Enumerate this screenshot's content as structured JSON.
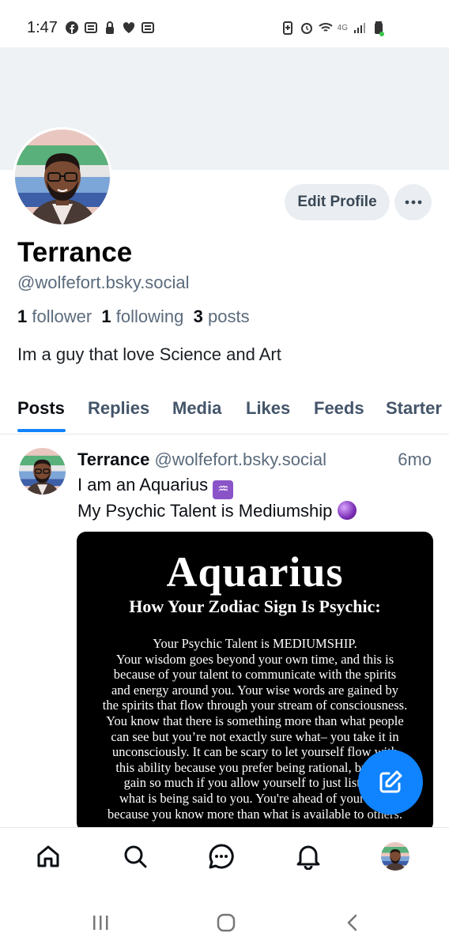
{
  "status_bar": {
    "time": "1:47",
    "left_icons": [
      "facebook-icon",
      "news-icon",
      "lock-icon",
      "heart-icon",
      "news-icon"
    ],
    "right_icons": [
      "battery-saver-icon",
      "alarm-icon",
      "wifi-icon",
      "signal-icon",
      "battery-icon"
    ],
    "network": "4G"
  },
  "profile": {
    "name": "Terrance",
    "handle": "@wolfefort.bsky.social",
    "followers_count": "1",
    "followers_label": "follower",
    "following_count": "1",
    "following_label": "following",
    "posts_count": "3",
    "posts_label": "posts",
    "bio": "Im a guy that love Science and Art",
    "edit_label": "Edit Profile",
    "more_label": "···"
  },
  "tabs": [
    {
      "label": "Posts",
      "active": true
    },
    {
      "label": "Replies",
      "active": false
    },
    {
      "label": "Media",
      "active": false
    },
    {
      "label": "Likes",
      "active": false
    },
    {
      "label": "Feeds",
      "active": false
    },
    {
      "label": "Starter",
      "active": false
    }
  ],
  "post": {
    "author": "Terrance",
    "handle": "@wolfefort.bsky.social",
    "time": "6mo",
    "line1": "I am an Aquarius",
    "line1_emoji": "♒",
    "line2": "My Psychic Talent is Mediumship",
    "line2_emoji": "crystal-ball",
    "image": {
      "title": "Aquarius",
      "subtitle": "How Your Zodiac Sign Is Psychic:",
      "body": [
        "Your Psychic Talent is MEDIUMSHIP.",
        "Your wisdom goes beyond your own time, and this is",
        "because of your talent to communicate with the spirits",
        "and energy around you. Your wise words are gained by",
        "the spirits that flow through your stream of consciousness.",
        "You know that there is something more than what people",
        "can see but you’re not exactly sure what– you take it in",
        "unconsciously. It can be scary to let yourself flow with",
        "this ability because you prefer being rational, but you",
        "gain so much if you allow yourself to just listen to",
        "what is being said to you. You're ahead of your time",
        "because you know more than what is available to others."
      ]
    }
  },
  "bottom_nav": [
    "home-icon",
    "search-icon",
    "chat-icon",
    "bell-icon",
    "profile-avatar"
  ],
  "colors": {
    "accent": "#1083fe",
    "banner": "#eff2f5",
    "muted_text": "#5b6b7c"
  }
}
